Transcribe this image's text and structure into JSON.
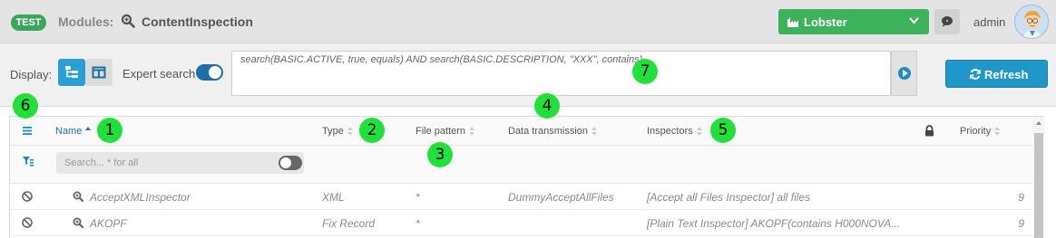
{
  "header": {
    "env_badge": "TEST",
    "modules_label": "Modules:",
    "page_title": "ContentInspection",
    "tenant": "Lobster",
    "user": "admin"
  },
  "toolbar": {
    "display_label": "Display:",
    "expert_label": "Expert search",
    "query": "search(BASIC.ACTIVE, true, equals) AND search(BASIC.DESCRIPTION, \"XXX\", contains)",
    "refresh_label": "Refresh"
  },
  "columns": {
    "name": "Name",
    "type": "Type",
    "file_pattern": "File pattern",
    "data_transmission": "Data transmission",
    "inspectors": "Inspectors",
    "priority": "Priority"
  },
  "filter": {
    "placeholder": "Search... * for all"
  },
  "rows": [
    {
      "name": "AcceptXMLInspector",
      "type": "XML",
      "file_pattern": "*",
      "data_transmission": "DummyAcceptAllFiles",
      "inspectors": "[Accept all Files Inspector] all files",
      "priority": "9"
    },
    {
      "name": "AKOPF",
      "type": "Fix Record",
      "file_pattern": "*",
      "data_transmission": "",
      "inspectors": "[Plain Text Inspector] AKOPF(contains H000NOVA...",
      "priority": "9"
    }
  ],
  "markers": [
    "1",
    "2",
    "3",
    "4",
    "5",
    "6",
    "7"
  ],
  "colors": {
    "accent": "#2a9fd6",
    "tenant_green": "#3cb35b",
    "marker_green": "#22e03a"
  }
}
